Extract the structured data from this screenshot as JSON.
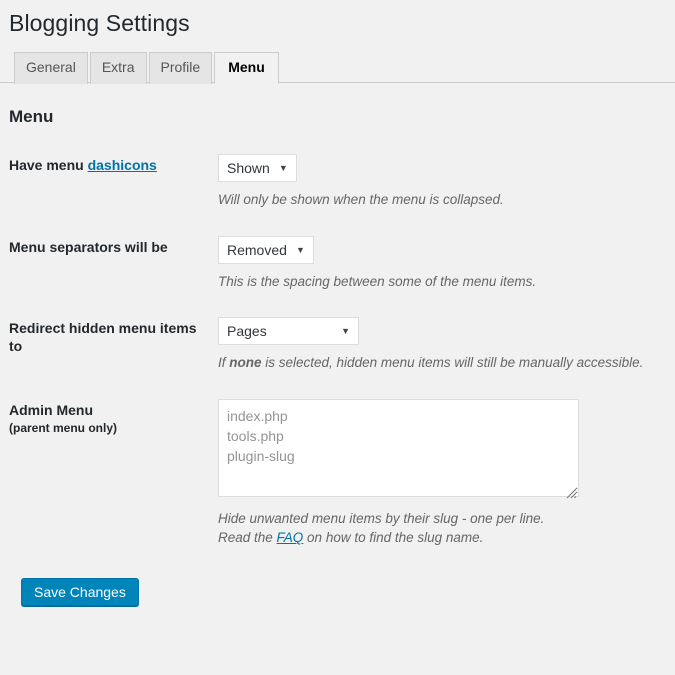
{
  "page": {
    "title": "Blogging Settings",
    "section_heading": "Menu"
  },
  "tabs": [
    {
      "label": "General",
      "active": false
    },
    {
      "label": "Extra",
      "active": false
    },
    {
      "label": "Profile",
      "active": false
    },
    {
      "label": "Menu",
      "active": true
    }
  ],
  "fields": {
    "dashicons": {
      "label_prefix": "Have menu ",
      "label_link": "dashicons",
      "select_value": "Shown",
      "description": "Will only be shown when the menu is collapsed."
    },
    "separators": {
      "label": "Menu separators will be",
      "select_value": "Removed",
      "description": "This is the spacing between some of the menu items."
    },
    "redirect": {
      "label": "Redirect hidden menu items to",
      "select_value": "Pages",
      "description_prefix": "If ",
      "description_bold": "none",
      "description_suffix": " is selected, hidden menu items will still be manually accessible."
    },
    "admin_menu": {
      "label": "Admin Menu",
      "sublabel": "(parent menu only)",
      "textarea_value": "",
      "textarea_placeholder": "index.php\ntools.php\nplugin-slug",
      "description_line1": "Hide unwanted menu items by their slug - one per line.",
      "description_line2_prefix": "Read the ",
      "description_line2_link": "FAQ",
      "description_line2_suffix": " on how to find the slug name."
    }
  },
  "submit": {
    "label": "Save Changes"
  },
  "icons": {
    "select_arrow": "▼"
  },
  "colors": {
    "page_background": "#f1f1f1",
    "link": "#0073aa",
    "primary_button": "#0085ba",
    "text": "#23282d",
    "description_text": "#666666",
    "placeholder_text": "#949494",
    "border": "#cccccc"
  }
}
